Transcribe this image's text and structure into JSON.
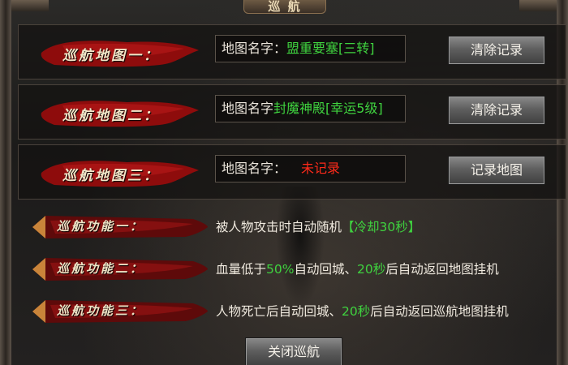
{
  "window": {
    "title": "巡 航"
  },
  "map_rows": [
    {
      "banner": "巡航地图一：",
      "field_label": "地图名字：",
      "field_value": "盟重要塞[三转]",
      "value_state": "set",
      "button_label": "清除记录"
    },
    {
      "banner": "巡航地图二：",
      "field_label": "地图名字",
      "field_value": "封魔神殿[幸运5级]",
      "value_state": "set",
      "button_label": "清除记录"
    },
    {
      "banner": "巡航地图三：",
      "field_label": "地图名字：",
      "field_value": "未记录",
      "value_state": "unset",
      "button_label": "记录地图"
    }
  ],
  "features": [
    {
      "banner": "巡航功能一：",
      "desc_parts": [
        "被人物攻击时自动随机",
        "【冷却30秒】"
      ]
    },
    {
      "banner": "巡航功能二：",
      "desc_parts": [
        "血量低于",
        "50%",
        "自动回城、",
        "20秒",
        "后自动返回地图挂机"
      ]
    },
    {
      "banner": "巡航功能三：",
      "desc_parts": [
        "人物死亡后自动回城、",
        "20秒",
        "后自动返回巡航地图挂机"
      ]
    }
  ],
  "close_button": "关闭巡航",
  "colors": {
    "value_green": "#3fd23f",
    "value_red": "#ff2a1a",
    "banner_red": "#9c1010"
  },
  "icons": [
    "map-banner-icon",
    "feature-banner-icon"
  ]
}
